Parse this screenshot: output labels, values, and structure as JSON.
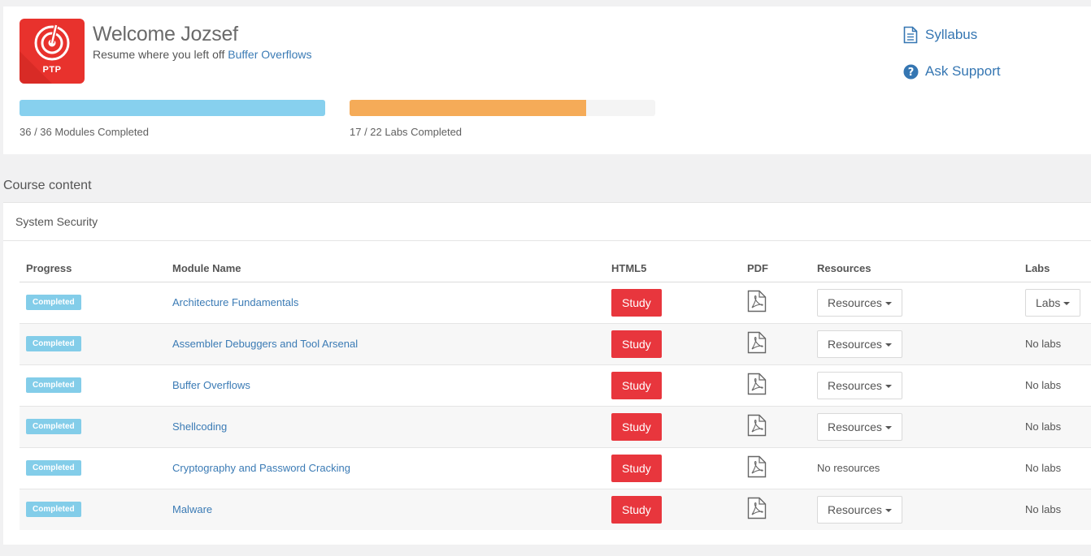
{
  "header": {
    "logo_text": "PTP",
    "welcome": "Welcome Jozsef",
    "resume_prefix": "Resume where you left off",
    "resume_link": "Buffer Overflows",
    "links": [
      {
        "label": "Syllabus",
        "icon": "document-icon"
      },
      {
        "label": "Ask Support",
        "icon": "question-circle-icon"
      }
    ],
    "progress": [
      {
        "label": "36 / 36 Modules Completed",
        "fraction": 1.0,
        "color": "#87d0ee"
      },
      {
        "label": "17 / 22 Labs Completed",
        "fraction": 0.773,
        "color": "#f5ab58"
      }
    ]
  },
  "content": {
    "heading": "Course content",
    "section_title": "System Security",
    "columns": [
      "Progress",
      "Module Name",
      "HTML5",
      "PDF",
      "Resources",
      "Labs"
    ],
    "rows": [
      {
        "status": "Completed",
        "name": "Architecture Fundamentals",
        "study": "Study",
        "resources": "Resources",
        "resources_dropdown": true,
        "labs": "Labs",
        "labs_dropdown": true
      },
      {
        "status": "Completed",
        "name": "Assembler Debuggers and Tool Arsenal",
        "study": "Study",
        "resources": "Resources",
        "resources_dropdown": true,
        "labs": "No labs",
        "labs_dropdown": false
      },
      {
        "status": "Completed",
        "name": "Buffer Overflows",
        "study": "Study",
        "resources": "Resources",
        "resources_dropdown": true,
        "labs": "No labs",
        "labs_dropdown": false
      },
      {
        "status": "Completed",
        "name": "Shellcoding",
        "study": "Study",
        "resources": "Resources",
        "resources_dropdown": true,
        "labs": "No labs",
        "labs_dropdown": false
      },
      {
        "status": "Completed",
        "name": "Cryptography and Password Cracking",
        "study": "Study",
        "resources": "No resources",
        "resources_dropdown": false,
        "labs": "No labs",
        "labs_dropdown": false
      },
      {
        "status": "Completed",
        "name": "Malware",
        "study": "Study",
        "resources": "Resources",
        "resources_dropdown": true,
        "labs": "No labs",
        "labs_dropdown": false
      }
    ]
  },
  "colors": {
    "accent": "#e8363d",
    "link": "#3b7bb5",
    "badge": "#83cde9"
  }
}
